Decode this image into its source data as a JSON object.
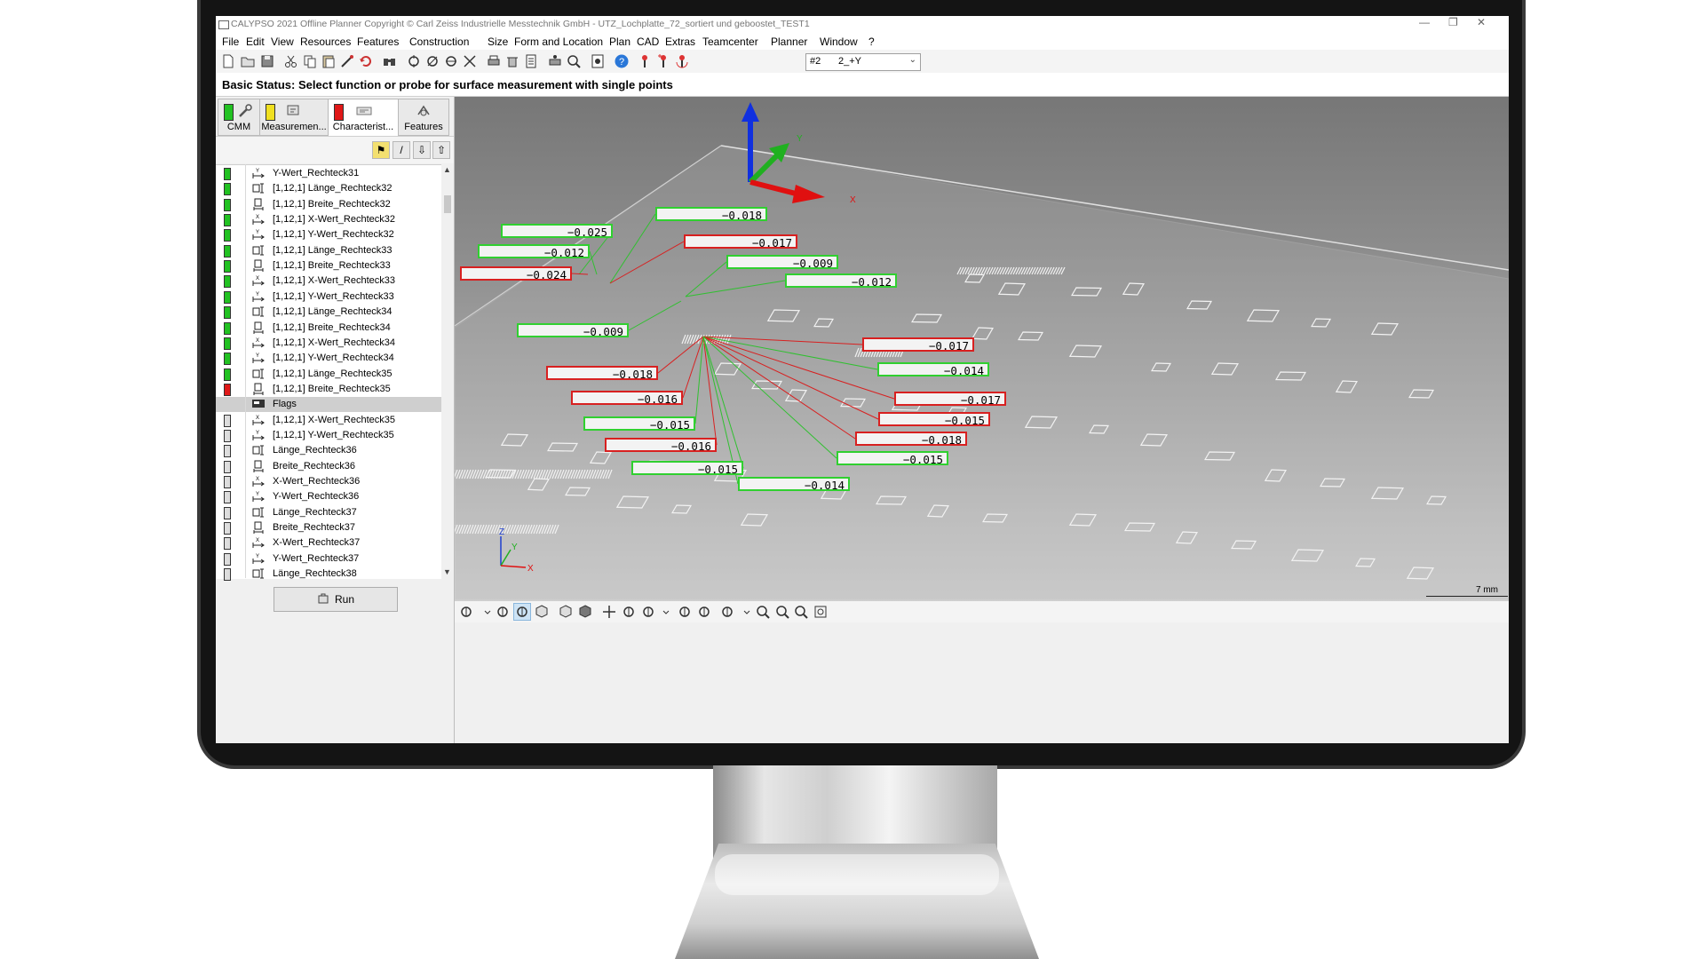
{
  "window": {
    "title": "CALYPSO 2021 Offline Planner Copyright © Carl Zeiss Industrielle Messtechnik GmbH - UTZ_Lochplatte_72_sortiert und geboostet_TEST1",
    "controls": {
      "minimize": "—",
      "maximize": "❐",
      "close": "✕"
    }
  },
  "menu": [
    "File",
    "Edit",
    "View",
    "Resources",
    "Features",
    "Construction",
    "Size",
    "Form and Location",
    "Plan",
    "CAD",
    "Extras",
    "Teamcenter",
    "Planner",
    "Window",
    "?"
  ],
  "toolbar": {
    "icons": [
      "new-icon",
      "open-icon",
      "save-icon",
      "cut-icon",
      "copy-icon",
      "paste-icon",
      "probe-icon",
      "undo-icon",
      "find-icon",
      "tool-icon",
      "tool2-icon",
      "tool3-icon",
      "tool4-icon",
      "print-icon",
      "delete-icon",
      "list-icon",
      "print2-icon",
      "zoom-icon",
      "stop-icon",
      "help-icon",
      "probe-change-icon",
      "probe-add-icon",
      "probe-rotate-icon"
    ],
    "probe_number": "#2",
    "probe_value": "2_+Y"
  },
  "status": {
    "text": "Basic Status: Select function or probe for surface measurement with single points"
  },
  "tabs": [
    {
      "label": "CMM",
      "status_color": "#22c222"
    },
    {
      "label": "Measuremen...",
      "status_color": "#f0e020"
    },
    {
      "label": "Characterist...",
      "status_color": "#e01818"
    },
    {
      "label": "Features",
      "status_color": ""
    }
  ],
  "list": {
    "items": [
      {
        "label": "Y-Wert_Rechteck31",
        "status": "#22c222",
        "icon": "y-value-icon"
      },
      {
        "label": "[1,12,1] Länge_Rechteck32",
        "status": "#22c222",
        "icon": "length-icon"
      },
      {
        "label": "[1,12,1] Breite_Rechteck32",
        "status": "#22c222",
        "icon": "width-icon"
      },
      {
        "label": "[1,12,1] X-Wert_Rechteck32",
        "status": "#22c222",
        "icon": "x-value-icon"
      },
      {
        "label": "[1,12,1] Y-Wert_Rechteck32",
        "status": "#22c222",
        "icon": "y-value-icon"
      },
      {
        "label": "[1,12,1] Länge_Rechteck33",
        "status": "#22c222",
        "icon": "length-icon"
      },
      {
        "label": "[1,12,1] Breite_Rechteck33",
        "status": "#22c222",
        "icon": "width-icon"
      },
      {
        "label": "[1,12,1] X-Wert_Rechteck33",
        "status": "#22c222",
        "icon": "x-value-icon"
      },
      {
        "label": "[1,12,1] Y-Wert_Rechteck33",
        "status": "#22c222",
        "icon": "y-value-icon"
      },
      {
        "label": "[1,12,1] Länge_Rechteck34",
        "status": "#22c222",
        "icon": "length-icon"
      },
      {
        "label": "[1,12,1] Breite_Rechteck34",
        "status": "#22c222",
        "icon": "width-icon"
      },
      {
        "label": "[1,12,1] X-Wert_Rechteck34",
        "status": "#22c222",
        "icon": "x-value-icon"
      },
      {
        "label": "[1,12,1] Y-Wert_Rechteck34",
        "status": "#22c222",
        "icon": "y-value-icon"
      },
      {
        "label": "[1,12,1] Länge_Rechteck35",
        "status": "#22c222",
        "icon": "length-icon"
      },
      {
        "label": "[1,12,1] Breite_Rechteck35",
        "status": "#e01818",
        "icon": "width-icon"
      },
      {
        "label": "Flags",
        "status": "",
        "icon": "flags-icon",
        "selected": true
      },
      {
        "label": "[1,12,1] X-Wert_Rechteck35",
        "status": "#dddddd",
        "icon": "x-value-icon"
      },
      {
        "label": "[1,12,1] Y-Wert_Rechteck35",
        "status": "#dddddd",
        "icon": "y-value-icon"
      },
      {
        "label": "Länge_Rechteck36",
        "status": "#dddddd",
        "icon": "length-icon"
      },
      {
        "label": "Breite_Rechteck36",
        "status": "#dddddd",
        "icon": "width-icon"
      },
      {
        "label": "X-Wert_Rechteck36",
        "status": "#dddddd",
        "icon": "x-value-icon"
      },
      {
        "label": "Y-Wert_Rechteck36",
        "status": "#dddddd",
        "icon": "y-value-icon"
      },
      {
        "label": "Länge_Rechteck37",
        "status": "#dddddd",
        "icon": "length-icon"
      },
      {
        "label": "Breite_Rechteck37",
        "status": "#dddddd",
        "icon": "width-icon"
      },
      {
        "label": "X-Wert_Rechteck37",
        "status": "#dddddd",
        "icon": "x-value-icon"
      },
      {
        "label": "Y-Wert_Rechteck37",
        "status": "#dddddd",
        "icon": "y-value-icon"
      },
      {
        "label": "Länge_Rechteck38",
        "status": "#dddddd",
        "icon": "length-icon"
      }
    ]
  },
  "run_button": {
    "label": "Run"
  },
  "view3d": {
    "axes_big": {
      "x": "X",
      "y": "Y"
    },
    "axes_small": {
      "x": "X",
      "y": "Y",
      "z": "Z"
    },
    "scale_label": "7 mm",
    "values": [
      {
        "text": "-0.025",
        "status": "green"
      },
      {
        "text": "-0.018",
        "status": "green"
      },
      {
        "text": "-0.012",
        "status": "green"
      },
      {
        "text": "-0.017",
        "status": "red"
      },
      {
        "text": "-0.024",
        "status": "red"
      },
      {
        "text": "-0.009",
        "status": "green"
      },
      {
        "text": "-0.012",
        "status": "green"
      },
      {
        "text": "-0.009",
        "status": "green"
      },
      {
        "text": "-0.017",
        "status": "red"
      },
      {
        "text": "-0.018",
        "status": "red"
      },
      {
        "text": "-0.014",
        "status": "green"
      },
      {
        "text": "-0.016",
        "status": "red"
      },
      {
        "text": "-0.017",
        "status": "red"
      },
      {
        "text": "-0.015",
        "status": "red"
      },
      {
        "text": "-0.015",
        "status": "green"
      },
      {
        "text": "-0.018",
        "status": "red"
      },
      {
        "text": "-0.016",
        "status": "red"
      },
      {
        "text": "-0.015",
        "status": "green"
      },
      {
        "text": "-0.015",
        "status": "green"
      },
      {
        "text": "-0.014",
        "status": "green"
      }
    ]
  },
  "view_toolbar": {
    "icons": [
      "select-icon",
      "chevron-down-icon",
      "probe-view-icon",
      "probe-view2-icon",
      "cube-icon",
      "cube2-icon",
      "cube3-icon",
      "pan-icon",
      "rotate-icon",
      "probe-rotate-icon",
      "chevron-down-icon",
      "rotate-left-icon",
      "rotate-right-icon",
      "axis-icon",
      "chevron-down-icon",
      "zoom-out-icon",
      "zoom-in-icon",
      "zoom-icon",
      "fit-icon"
    ]
  }
}
